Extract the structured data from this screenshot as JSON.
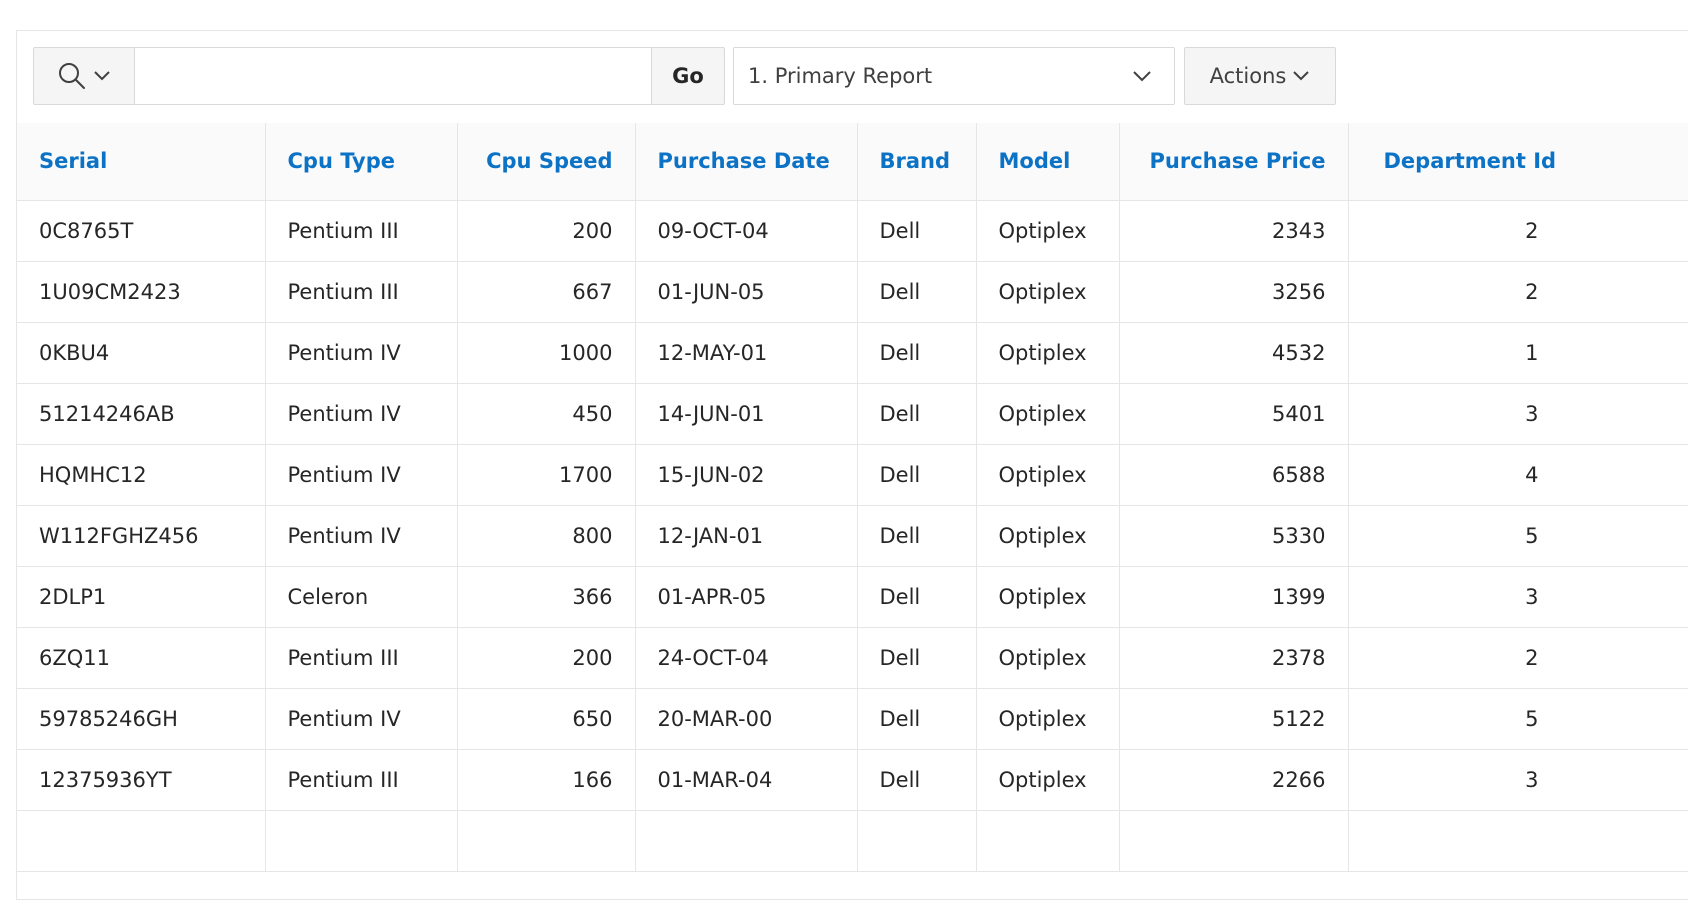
{
  "toolbar": {
    "search_value": "",
    "go_label": "Go",
    "report_selected": "1. Primary Report",
    "actions_label": "Actions"
  },
  "table": {
    "columns": [
      "Serial",
      "Cpu Type",
      "Cpu Speed",
      "Purchase Date",
      "Brand",
      "Model",
      "Purchase Price",
      "Department Id"
    ],
    "rows": [
      [
        "0C8765T",
        "Pentium III",
        "200",
        "09-OCT-04",
        "Dell",
        "Optiplex",
        "2343",
        "2"
      ],
      [
        "1U09CM2423",
        "Pentium III",
        "667",
        "01-JUN-05",
        "Dell",
        "Optiplex",
        "3256",
        "2"
      ],
      [
        "0KBU4",
        "Pentium IV",
        "1000",
        "12-MAY-01",
        "Dell",
        "Optiplex",
        "4532",
        "1"
      ],
      [
        "51214246AB",
        "Pentium IV",
        "450",
        "14-JUN-01",
        "Dell",
        "Optiplex",
        "5401",
        "3"
      ],
      [
        "HQMHC12",
        "Pentium IV",
        "1700",
        "15-JUN-02",
        "Dell",
        "Optiplex",
        "6588",
        "4"
      ],
      [
        "W112FGHZ456",
        "Pentium IV",
        "800",
        "12-JAN-01",
        "Dell",
        "Optiplex",
        "5330",
        "5"
      ],
      [
        "2DLP1",
        "Celeron",
        "366",
        "01-APR-05",
        "Dell",
        "Optiplex",
        "1399",
        "3"
      ],
      [
        "6ZQ11",
        "Pentium III",
        "200",
        "24-OCT-04",
        "Dell",
        "Optiplex",
        "2378",
        "2"
      ],
      [
        "59785246GH",
        "Pentium IV",
        "650",
        "20-MAR-00",
        "Dell",
        "Optiplex",
        "5122",
        "5"
      ],
      [
        "12375936YT",
        "Pentium III",
        "166",
        "01-MAR-04",
        "Dell",
        "Optiplex",
        "2266",
        "3"
      ],
      [
        "",
        "",
        "",
        "",
        "",
        "",
        "",
        ""
      ]
    ]
  }
}
